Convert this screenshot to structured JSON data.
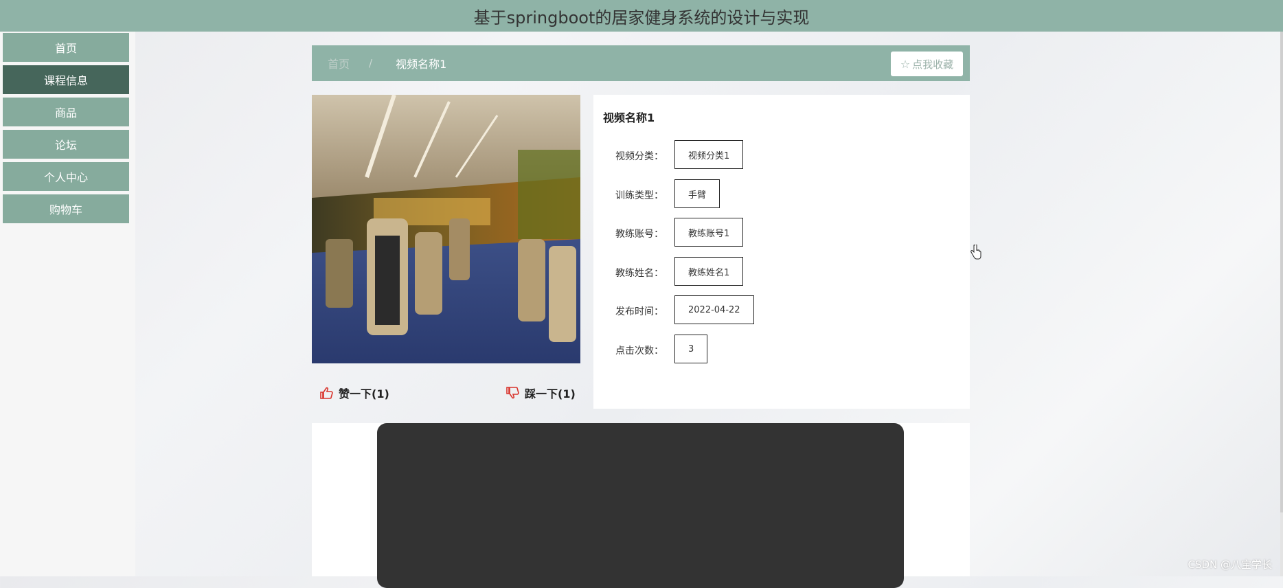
{
  "header": {
    "title": "基于springboot的居家健身系统的设计与实现"
  },
  "sidebar": {
    "items": [
      {
        "label": "首页",
        "active": false
      },
      {
        "label": "课程信息",
        "active": true
      },
      {
        "label": "商品",
        "active": false
      },
      {
        "label": "论坛",
        "active": false
      },
      {
        "label": "个人中心",
        "active": false
      },
      {
        "label": "购物车",
        "active": false
      }
    ]
  },
  "breadcrumb": {
    "home": "首页",
    "separator": "/",
    "current": "视频名称1"
  },
  "favorite_button": {
    "label": "点我收藏",
    "icon": "star-outline-icon"
  },
  "votes": {
    "like": {
      "label": "赞一下(1)",
      "icon": "thumbs-up-icon"
    },
    "dislike": {
      "label": "踩一下(1)",
      "icon": "thumbs-down-icon"
    }
  },
  "detail": {
    "title": "视频名称1",
    "fields": [
      {
        "label": "视频分类：",
        "value": "视频分类1"
      },
      {
        "label": "训练类型：",
        "value": "手臂"
      },
      {
        "label": "教练账号：",
        "value": "教练账号1"
      },
      {
        "label": "教练姓名：",
        "value": "教练姓名1"
      },
      {
        "label": "发布时间：",
        "value": "2022-04-22"
      },
      {
        "label": "点击次数：",
        "value": "3"
      }
    ]
  },
  "watermark": "CSDN @八宝学长",
  "colors": {
    "accent": "#8fb3a7",
    "accent_active": "#46665b",
    "sidebar_item": "#86ab9d",
    "vote_icon": "#d9332b"
  }
}
